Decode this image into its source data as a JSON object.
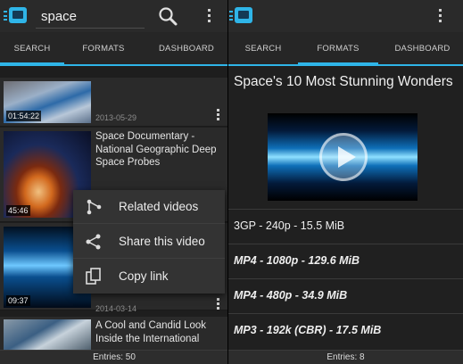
{
  "left": {
    "search_value": "space",
    "tabs": [
      "SEARCH",
      "FORMATS",
      "DASHBOARD"
    ],
    "active_tab": "SEARCH",
    "results": [
      {
        "duration": "01:54:22",
        "title": "",
        "date": "2013-05-29"
      },
      {
        "duration": "45:46",
        "title": "Space Documentary - National Geographic Deep Space Probes",
        "date": ""
      },
      {
        "duration": "09:37",
        "title": "",
        "date": "2014-03-14"
      },
      {
        "duration": "",
        "title": "A Cool and Candid Look Inside the International",
        "date": ""
      }
    ],
    "context_menu": [
      {
        "label": "Related videos",
        "icon": "related-icon"
      },
      {
        "label": "Share this video",
        "icon": "share-icon"
      },
      {
        "label": "Copy link",
        "icon": "copy-icon"
      }
    ],
    "footer": "Entries: 50"
  },
  "right": {
    "tabs": [
      "SEARCH",
      "FORMATS",
      "DASHBOARD"
    ],
    "active_tab": "FORMATS",
    "video_title": "Space's 10 Most Stunning Wonders",
    "formats": [
      {
        "label": "3GP - 240p - 15.5 MiB",
        "emphasis": false
      },
      {
        "label": "MP4 - 1080p - 129.6 MiB",
        "emphasis": true
      },
      {
        "label": "MP4 - 480p - 34.9 MiB",
        "emphasis": true
      },
      {
        "label": "MP3 - 192k (CBR) - 17.5 MiB",
        "emphasis": true
      }
    ],
    "footer": "Entries: 8"
  },
  "colors": {
    "accent": "#2fb5e8",
    "background": "#1e1e1e",
    "actionbar": "#2a2a2a"
  }
}
